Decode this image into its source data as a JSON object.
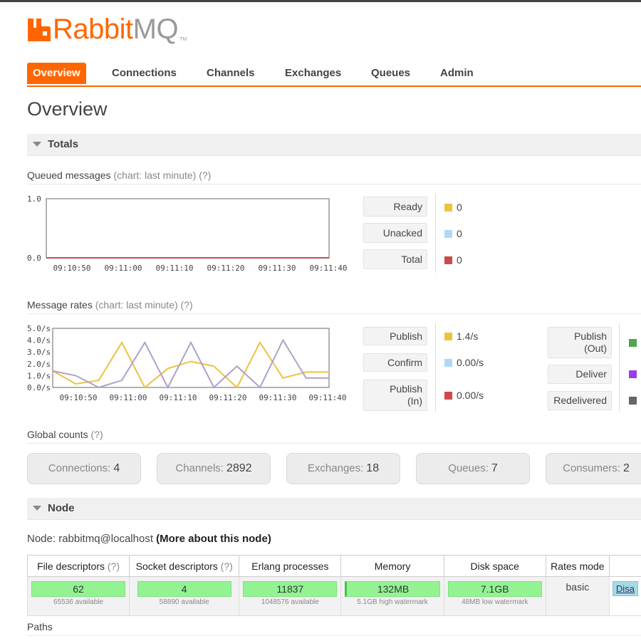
{
  "app": {
    "logo_part1": "Rabbit",
    "logo_part2": "MQ",
    "logo_tm": "TM",
    "brand_color": "#ff6600"
  },
  "tabs": [
    {
      "label": "Overview",
      "active": true
    },
    {
      "label": "Connections"
    },
    {
      "label": "Channels"
    },
    {
      "label": "Exchanges"
    },
    {
      "label": "Queues"
    },
    {
      "label": "Admin"
    }
  ],
  "page_title": "Overview",
  "totals": {
    "header": "Totals",
    "queued": {
      "title": "Queued messages",
      "subtitle": "(chart: last minute)",
      "help": "(?)",
      "legend": [
        {
          "label": "Ready",
          "value": "0",
          "color": "#edc240"
        },
        {
          "label": "Unacked",
          "value": "0",
          "color": "#afd8f8"
        },
        {
          "label": "Total",
          "value": "0",
          "color": "#cb4b4b"
        }
      ]
    },
    "rates": {
      "title": "Message rates",
      "subtitle": "(chart: last minute)",
      "help": "(?)",
      "legend": [
        {
          "label": "Publish",
          "value": "1.4/s",
          "color": "#edc240"
        },
        {
          "label": "Confirm",
          "value": "0.00/s",
          "color": "#afd8f8"
        },
        {
          "label": "Publish\n(In)",
          "value": "0.00/s",
          "color": "#cb4b4b"
        }
      ],
      "legend2": [
        {
          "label": "Publish\n(Out)",
          "color": "#4da74d"
        },
        {
          "label": "Deliver",
          "color": "#9440ed"
        },
        {
          "label": "Redelivered",
          "color": "#666666"
        }
      ]
    }
  },
  "chart_data": [
    {
      "type": "line",
      "x": [
        "09:10:50",
        "09:11:00",
        "09:11:10",
        "09:11:20",
        "09:11:30",
        "09:11:40"
      ],
      "ylim": [
        0,
        1.0
      ],
      "yticks": [
        "1.0",
        "0.0"
      ],
      "series": [
        {
          "name": "Ready",
          "color": "#edc240",
          "values": [
            0,
            0,
            0,
            0,
            0,
            0
          ]
        },
        {
          "name": "Unacked",
          "color": "#afd8f8",
          "values": [
            0,
            0,
            0,
            0,
            0,
            0
          ]
        },
        {
          "name": "Total",
          "color": "#cb4b4b",
          "values": [
            0,
            0,
            0,
            0,
            0,
            0
          ]
        }
      ]
    },
    {
      "type": "line",
      "x": [
        "09:10:50",
        "09:11:00",
        "09:11:10",
        "09:11:20",
        "09:11:30",
        "09:11:40"
      ],
      "ylim": [
        0,
        5.0
      ],
      "yticks": [
        "5.0/s",
        "4.0/s",
        "3.0/s",
        "2.0/s",
        "1.0/s",
        "0.0/s"
      ],
      "series": [
        {
          "name": "Publish",
          "color": "#edc240",
          "t": [
            0,
            5,
            10,
            15,
            20,
            25,
            30,
            35,
            40,
            45,
            50,
            55,
            60
          ],
          "values": [
            1.4,
            0.3,
            0.6,
            3.8,
            0,
            1.6,
            2.2,
            1.8,
            0,
            3.8,
            0.8,
            1.3,
            1.3
          ]
        },
        {
          "name": "Deliver",
          "color": "#b0a0c8",
          "t": [
            0,
            5,
            10,
            15,
            20,
            25,
            30,
            35,
            40,
            45,
            50,
            55,
            60
          ],
          "values": [
            1.4,
            1.0,
            0,
            0.6,
            3.8,
            0,
            3.8,
            0,
            1.8,
            0,
            4.0,
            0.8,
            0.8
          ]
        }
      ]
    }
  ],
  "global_counts": {
    "title": "Global counts",
    "help": "(?)",
    "items": [
      {
        "label": "Connections:",
        "value": "4"
      },
      {
        "label": "Channels:",
        "value": "2892"
      },
      {
        "label": "Exchanges:",
        "value": "18"
      },
      {
        "label": "Queues:",
        "value": "7"
      },
      {
        "label": "Consumers:",
        "value": "2"
      }
    ]
  },
  "node": {
    "header": "Node",
    "node_prefix": "Node: rabbitmq@localhost",
    "more_link": "(More about this node)",
    "columns": [
      {
        "label": "File descriptors",
        "help": "(?)"
      },
      {
        "label": "Socket descriptors",
        "help": "(?)"
      },
      {
        "label": "Erlang processes"
      },
      {
        "label": "Memory"
      },
      {
        "label": "Disk space"
      },
      {
        "label": "Rates mode"
      }
    ],
    "values": [
      {
        "value": "62",
        "sub": "65536 available",
        "fill": 0.001
      },
      {
        "value": "4",
        "sub": "58890 available",
        "fill": 0.0001
      },
      {
        "value": "11837",
        "sub": "1048576 available",
        "fill": 0.011
      },
      {
        "value": "132MB",
        "sub": "5.1GB high watermark",
        "fill": 0.026
      },
      {
        "value": "7.1GB",
        "sub": "48MB low watermark",
        "fill": 1.0
      }
    ],
    "rates_mode": "basic",
    "disable_label": "Disa"
  },
  "paths_title": "Paths"
}
